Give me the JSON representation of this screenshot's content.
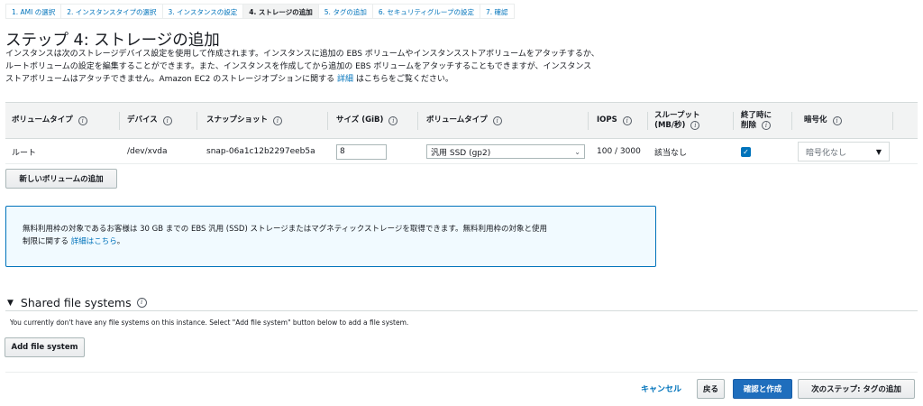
{
  "wizard": {
    "steps": [
      {
        "label": "1. AMI の選択"
      },
      {
        "label": "2. インスタンスタイプの選択"
      },
      {
        "label": "3. インスタンスの設定"
      },
      {
        "label": "4. ストレージの追加"
      },
      {
        "label": "5. タグの追加"
      },
      {
        "label": "6. セキュリティグループの設定"
      },
      {
        "label": "7. 確認"
      }
    ],
    "active_index": 3
  },
  "page": {
    "title": "ステップ 4: ストレージの追加",
    "description_line1": "インスタンスは次のストレージデバイス設定を使用して作成されます。インスタンスに追加の EBS ボリュームやインスタンスストアボリュームをアタッチするか、",
    "description_line2": "ルートボリュームの設定を編集することができます。また、インスタンスを作成してから追加の EBS ボリュームをアタッチすることもできますが、インスタンス",
    "description_line3_pre": "ストアボリュームはアタッチできません。Amazon EC2 のストレージオプションに関する ",
    "description_link": "詳細",
    "description_line3_post": " はこちらをご覧ください。"
  },
  "table": {
    "headers": {
      "volume_type": "ボリュームタイプ",
      "device": "デバイス",
      "snapshot": "スナップショット",
      "size": "サイズ (GiB)",
      "volume_kind": "ボリュームタイプ",
      "iops": "IOPS",
      "throughput_1": "スループット",
      "throughput_2": "(MB/秒)",
      "delete_1": "終了時に",
      "delete_2": "削除",
      "encryption": "暗号化"
    },
    "row": {
      "volume_type": "ルート",
      "device": "/dev/xvda",
      "snapshot": "snap-06a1c12b2297eeb5a",
      "size": "8",
      "volume_kind": "汎用 SSD (gp2)",
      "iops": "100 / 3000",
      "throughput": "該当なし",
      "delete_on_termination": true,
      "encryption": "暗号化なし"
    },
    "add_volume_label": "新しいボリュームの追加"
  },
  "info_box": {
    "line1": "無料利用枠の対象であるお客様は 30 GB までの EBS 汎用 (SSD) ストレージまたはマグネティックストレージを取得できます。無料利用枠の対象と使用",
    "line2_pre": "制限に関する ",
    "link": "詳細はこちら",
    "line2_post": "。"
  },
  "file_systems": {
    "title": "Shared file systems",
    "message": "You currently don't have any file systems on this instance. Select \"Add file system\" button below to add a file system.",
    "add_label": "Add file system"
  },
  "footer": {
    "cancel": "キャンセル",
    "back": "戻る",
    "review_launch": "確認と作成",
    "next": "次のステップ: タグの追加"
  },
  "colors": {
    "link": "#0073bb",
    "primary_button": "#1f6ebd",
    "info_bg": "#f1faff",
    "header_bg": "#f2f3f3"
  }
}
